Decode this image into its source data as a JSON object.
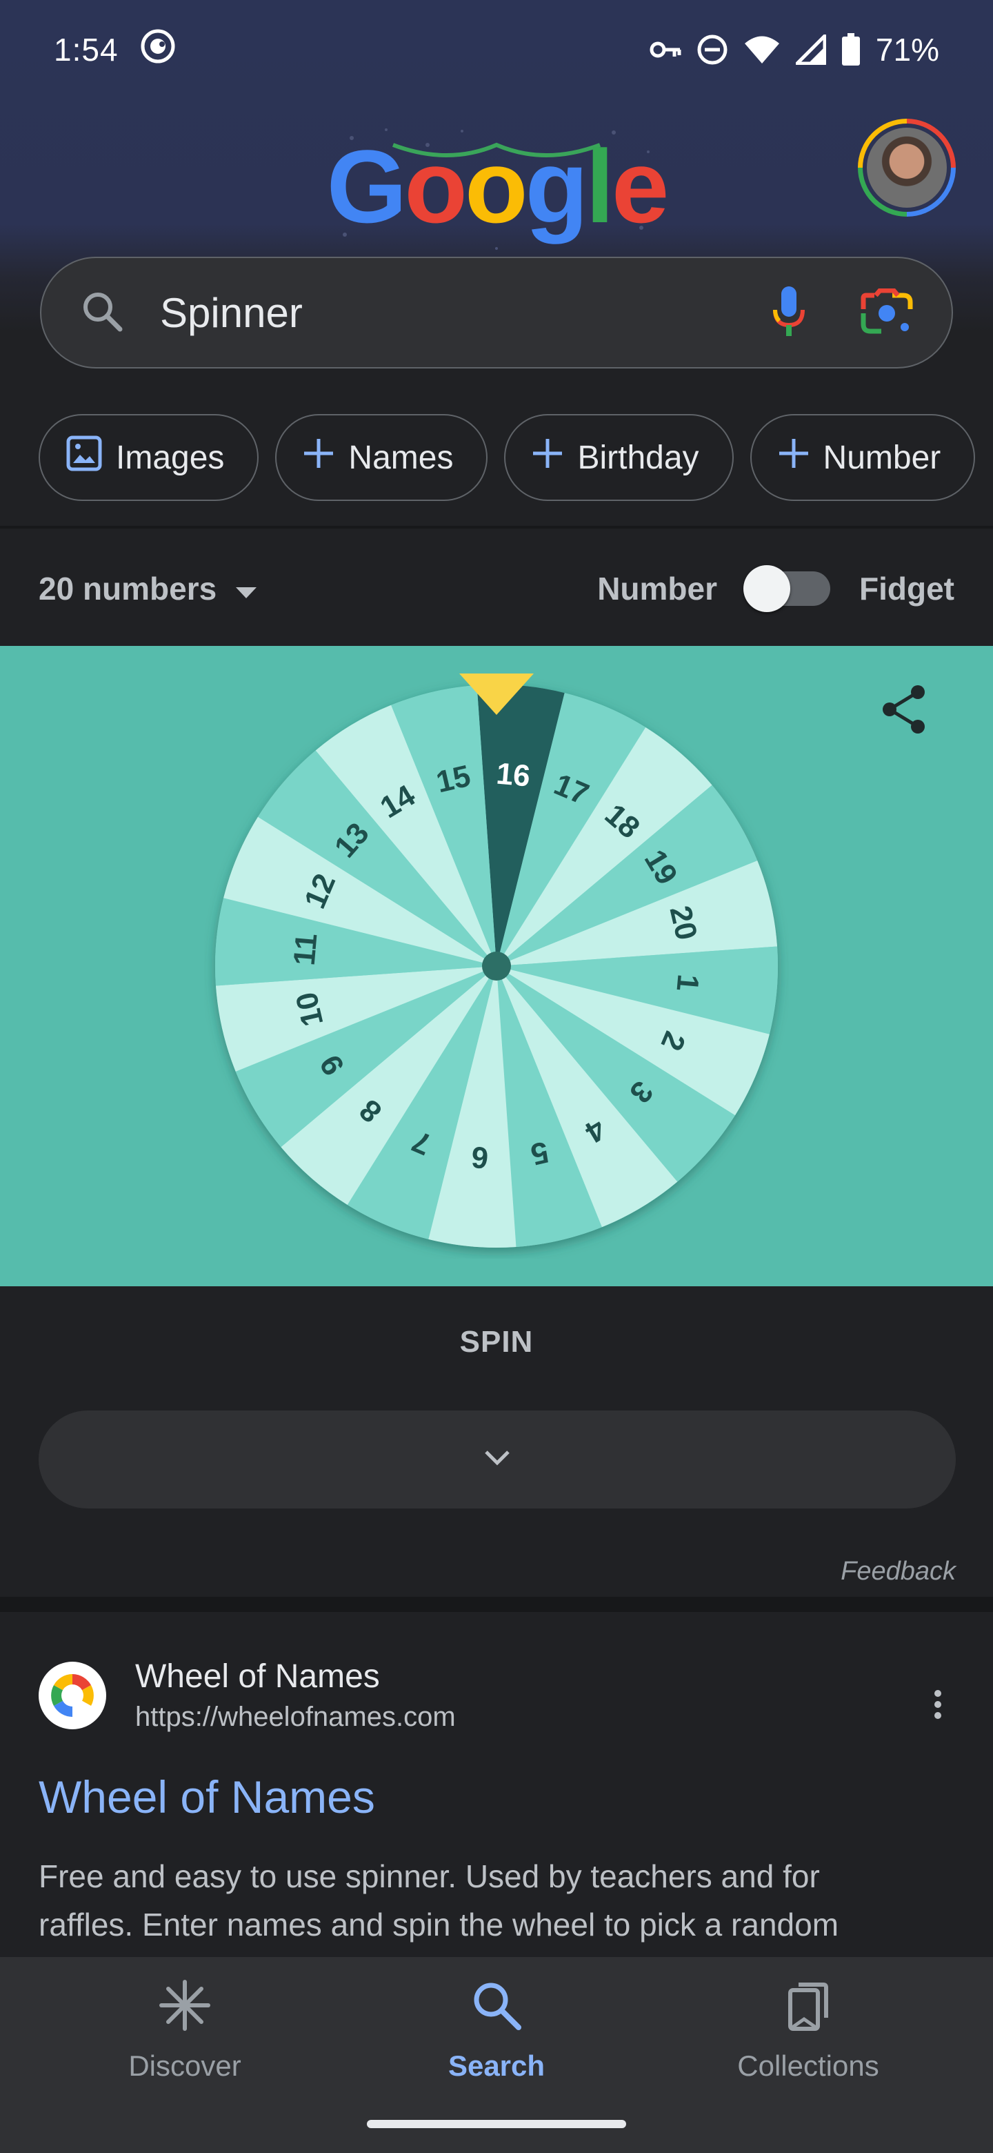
{
  "status_bar": {
    "time": "1:54",
    "battery": "71%",
    "icons": [
      "app-notification-icon",
      "vpn-key-icon",
      "do-not-disturb-icon",
      "wifi-icon",
      "cellular-signal-icon",
      "battery-icon"
    ]
  },
  "header": {
    "doodle_text": "Google",
    "avatar": "account-avatar"
  },
  "search": {
    "query": "Spinner",
    "icons": [
      "search-icon",
      "voice-search-icon",
      "lens-icon"
    ]
  },
  "chips": [
    {
      "label": "Images",
      "icon": "image-icon"
    },
    {
      "label": "Names",
      "icon": "plus-icon"
    },
    {
      "label": "Birthday",
      "icon": "plus-icon"
    },
    {
      "label": "Number",
      "icon": "plus-icon"
    }
  ],
  "spinner": {
    "count_label": "20 numbers",
    "mode_left": "Number",
    "mode_right": "Fidget",
    "toggle_on": false,
    "highlighted": "16",
    "spin_label": "SPIN",
    "feedback": "Feedback",
    "colors": {
      "background": "#56bcac",
      "light": "#c4f1e9",
      "medium": "#79d5c8",
      "highlight": "#225f5d",
      "pointer": "#f9d447"
    }
  },
  "wheel": {
    "numbers": [
      "16",
      "17",
      "18",
      "19",
      "20",
      "1",
      "2",
      "3",
      "4",
      "5",
      "6",
      "7",
      "8",
      "9",
      "10",
      "11",
      "12",
      "13",
      "14",
      "15"
    ]
  },
  "result": {
    "site_name": "Wheel of Names",
    "url": "https://wheelofnames.com",
    "title": "Wheel of Names",
    "snippet_line1": "Free and easy to use spinner. Used by teachers and for",
    "snippet_line2": "raffles. Enter names and spin the wheel to pick a random"
  },
  "bottom_nav": [
    {
      "label": "Discover",
      "icon": "discover-icon",
      "active": false
    },
    {
      "label": "Search",
      "icon": "search-icon",
      "active": true
    },
    {
      "label": "Collections",
      "icon": "collections-icon",
      "active": false
    }
  ]
}
